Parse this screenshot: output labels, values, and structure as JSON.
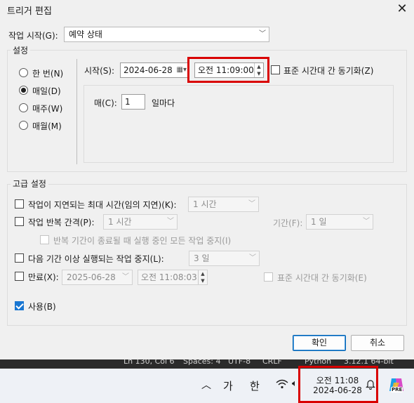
{
  "dialog": {
    "title": "트리거 편집",
    "start_task_label": "작업 시작(G):",
    "start_task_value": "예약 상태"
  },
  "settings": {
    "group_title": "설정",
    "radios": [
      {
        "label": "한 번(N)",
        "checked": false
      },
      {
        "label": "매일(D)",
        "checked": true
      },
      {
        "label": "매주(W)",
        "checked": false
      },
      {
        "label": "매월(M)",
        "checked": false
      }
    ],
    "start_label": "시작(S):",
    "start_date": "2024-06-28",
    "start_time": "오전 11:09:00",
    "sync_label": "표준 시간대 간 동기화(Z)",
    "every_label": "매(C):",
    "every_value": "1",
    "every_unit": "일마다"
  },
  "advanced": {
    "group_title": "고급 설정",
    "delay_label": "작업이 지연되는 최대 시간(임의 지연)(K):",
    "delay_value": "1 시간",
    "repeat_label": "작업 반복 간격(P):",
    "repeat_value": "1 시간",
    "duration_label": "기간(F):",
    "duration_value": "1 일",
    "stop_all_label": "반복 기간이 종료될 때 실행 중인 모든 작업 중지(I)",
    "stop_longer_label": "다음 기간 이상 실행되는 작업 중지(L):",
    "stop_longer_value": "3 일",
    "expire_label": "만료(X):",
    "expire_date": "2025-06-28",
    "expire_time": "오전 11:08:03",
    "expire_sync_label": "표준 시간대 간 동기화(E)",
    "enabled_label": "사용(B)",
    "enabled_checked": true
  },
  "buttons": {
    "ok": "확인",
    "cancel": "취소"
  },
  "statusbar": {
    "items": [
      "Ln 130, Col 6",
      "Spaces: 4",
      "UTF-8",
      "CRLF",
      "Python",
      "3.12.1 64-bit"
    ]
  },
  "taskbar": {
    "ime_mode": "가",
    "ime_lang": "한",
    "clock_time": "오전 11:08",
    "clock_date": "2024-06-28",
    "copilot_badge": "PRE"
  },
  "colors": {
    "accent": "#1976d2",
    "highlight_box": "#d90000"
  }
}
